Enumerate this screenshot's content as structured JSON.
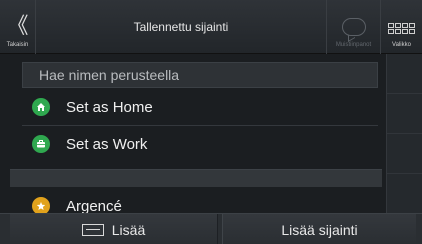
{
  "header": {
    "back_label": "Takaisin",
    "back_glyph": "《",
    "title": "Tallennettu sijainti",
    "notes_label": "Muistiinpanot",
    "menu_label": "Valikko"
  },
  "search": {
    "placeholder": "Hae nimen perusteella"
  },
  "list": {
    "items": [
      {
        "label": "Set as Home",
        "icon": "home-icon",
        "color": "#2fa84f"
      },
      {
        "label": "Set as Work",
        "icon": "briefcase-icon",
        "color": "#2fa84f"
      },
      {
        "label": "Argencé",
        "icon": "star-icon",
        "color": "#e1a21c"
      }
    ]
  },
  "footer": {
    "more_label": "Lisää",
    "add_location_label": "Lisää sijainti"
  }
}
